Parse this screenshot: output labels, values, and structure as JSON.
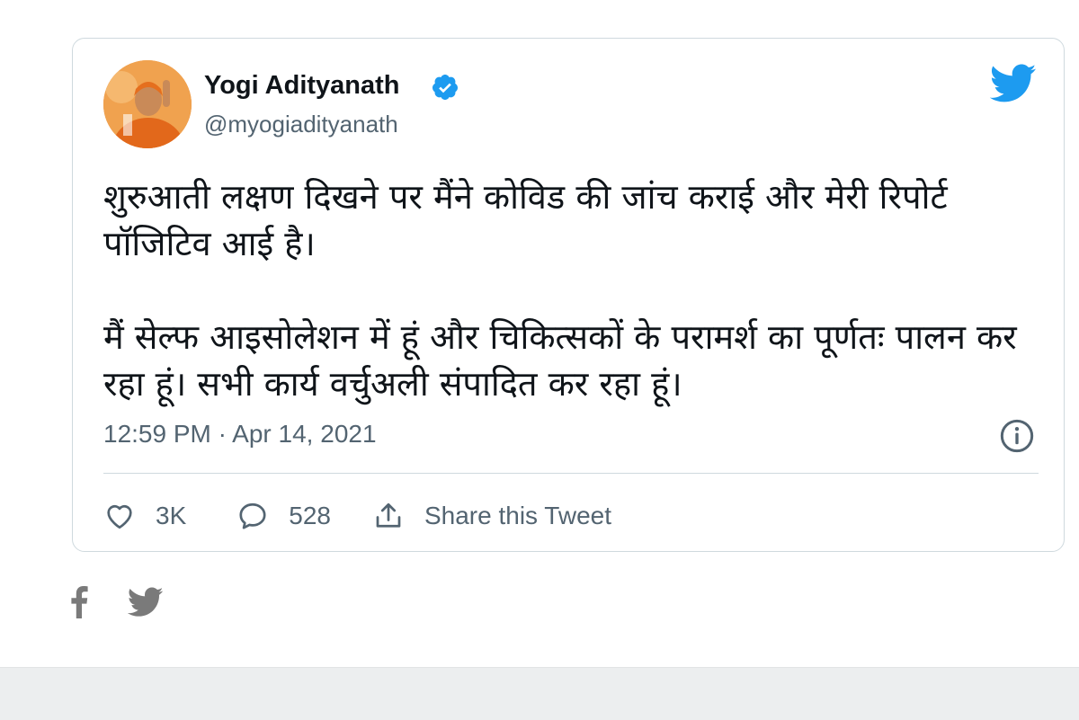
{
  "tweet": {
    "author_name": "Yogi Adityanath",
    "handle": "@myogiadityanath",
    "paragraphs": [
      "शुरुआती लक्षण दिखने पर मैंने कोविड की जांच कराई और मेरी रिपोर्ट पॉजिटिव आई है।",
      "मैं सेल्फ आइसोलेशन में हूं और चिकित्सकों के परामर्श का पूर्णतः पालन कर रहा हूं। सभी कार्य वर्चुअली संपादित कर रहा हूं।"
    ],
    "timestamp": "12:59 PM · Apr 14, 2021",
    "actions": {
      "like_count": "3K",
      "reply_count": "528",
      "share_label": "Share this Tweet"
    }
  },
  "icons": {
    "verified": "verified-badge-icon",
    "brand": "twitter-bird-icon",
    "info": "info-icon",
    "like": "heart-icon",
    "reply": "speech-bubble-icon",
    "share": "share-upload-icon",
    "page_share": [
      "facebook-icon",
      "twitter-icon"
    ]
  },
  "colors": {
    "twitter_blue": "#1d9bf0",
    "text_primary": "#0f1419",
    "text_secondary": "#536471",
    "border": "#cfd9de",
    "share_icon_gray": "#7a7a7a",
    "footer_band": "#eceeef"
  }
}
